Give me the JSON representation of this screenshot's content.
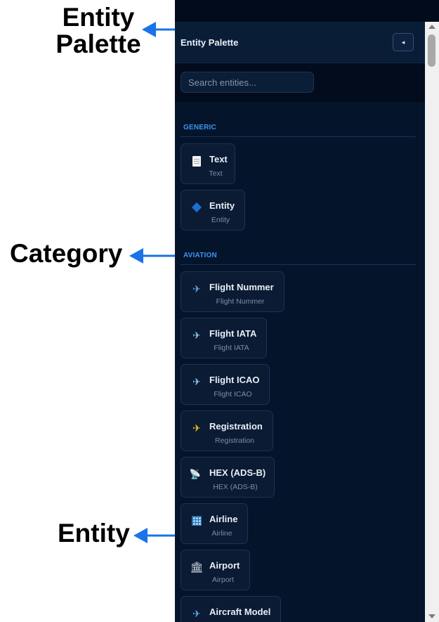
{
  "annotations": {
    "entity_palette_line1": "Entity",
    "entity_palette_line2": "Palette",
    "category": "Category",
    "entity": "Entity"
  },
  "panel": {
    "title": "Entity Palette",
    "collapse_symbol": "◂",
    "search_placeholder": "Search entities..."
  },
  "categories": [
    {
      "label": "GENERIC",
      "items": [
        {
          "title": "Text",
          "subtitle": "Text",
          "icon": "document-icon"
        },
        {
          "title": "Entity",
          "subtitle": "Entity",
          "icon": "blue-diamond-icon"
        }
      ]
    },
    {
      "label": "AVIATION",
      "items": [
        {
          "title": "Flight Nummer",
          "subtitle": "Flight Nummer",
          "icon": "airplane-icon"
        },
        {
          "title": "Flight IATA",
          "subtitle": "Flight IATA",
          "icon": "airplane-departure-icon"
        },
        {
          "title": "Flight ICAO",
          "subtitle": "Flight ICAO",
          "icon": "airplane-arrival-icon"
        },
        {
          "title": "Registration",
          "subtitle": "Registration",
          "icon": "small-airplane-icon"
        },
        {
          "title": "HEX (ADS-B)",
          "subtitle": "HEX (ADS-B)",
          "icon": "satellite-antenna-icon"
        },
        {
          "title": "Airline",
          "subtitle": "Airline",
          "icon": "office-building-icon"
        },
        {
          "title": "Airport",
          "subtitle": "Airport",
          "icon": "classical-building-icon"
        },
        {
          "title": "Aircraft Model",
          "subtitle": "",
          "icon": "airplane-icon"
        }
      ]
    }
  ],
  "colors": {
    "panel_bg": "#04152b",
    "category_accent": "#3d95ee",
    "annotation_arrow": "#1a73e8"
  }
}
